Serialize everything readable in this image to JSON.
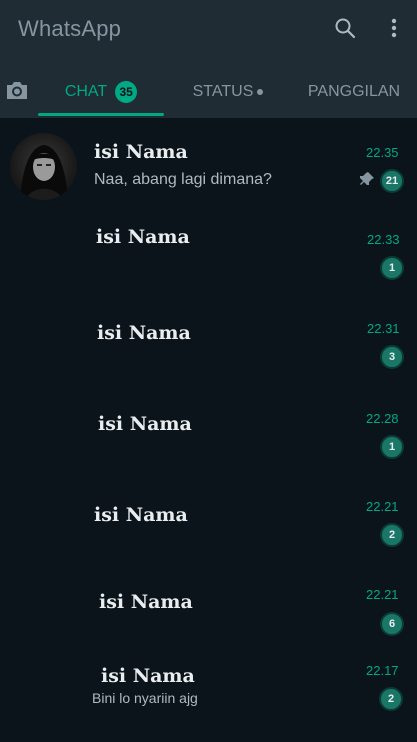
{
  "app": {
    "title": "WhatsApp"
  },
  "tabs": [
    {
      "label": "CHAT",
      "badge": "35"
    },
    {
      "label": "STATUS"
    },
    {
      "label": "PANGGILAN"
    }
  ],
  "colors": {
    "accent": "#00a884",
    "header": "#1f2c34",
    "background": "#0b141a"
  },
  "icons": [
    "search-icon",
    "menu-icon",
    "camera-icon",
    "pin-icon"
  ],
  "chats": [
    {
      "name": "isi  Nama",
      "message": "Naa, abang lagi dimana?",
      "time": "22.35",
      "unread": "21",
      "pinned": true
    },
    {
      "name": "isi  Nama",
      "message": "",
      "time": "22.33",
      "unread": "1"
    },
    {
      "name": "isi  Nama",
      "message": "",
      "time": "22.31",
      "unread": "3"
    },
    {
      "name": "isi  Nama",
      "message": "",
      "time": "22.28",
      "unread": "1"
    },
    {
      "name": "isi  Nama",
      "message": "",
      "time": "22.21",
      "unread": "2"
    },
    {
      "name": "isi  Nama",
      "message": "",
      "time": "22.21",
      "unread": "6"
    },
    {
      "name": "isi  Nama",
      "message": "Bini lo nyariin ajg",
      "time": "22.17",
      "unread": "2"
    }
  ]
}
